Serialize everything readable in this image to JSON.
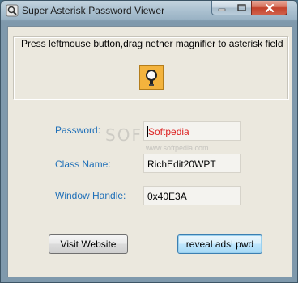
{
  "window": {
    "title": "Super Asterisk Password Viewer",
    "accent": "#1e6fb8",
    "close_color": "#c2412a"
  },
  "group": {
    "instruction": "Press leftmouse button,drag nether magnifier to asterisk field",
    "magnifier_icon": "magnifier-icon"
  },
  "fields": {
    "password": {
      "label": "Password:",
      "value": "Softpedia"
    },
    "class_name": {
      "label": "Class Name:",
      "value": "RichEdit20WPT"
    },
    "window_handle": {
      "label": "Window Handle:",
      "value": "0x40E3A"
    }
  },
  "buttons": {
    "visit_website": "Visit Website",
    "reveal": "reveal adsl pwd"
  },
  "watermark": {
    "text": "SOFTPEDIA",
    "url": "www.softpedia.com"
  }
}
